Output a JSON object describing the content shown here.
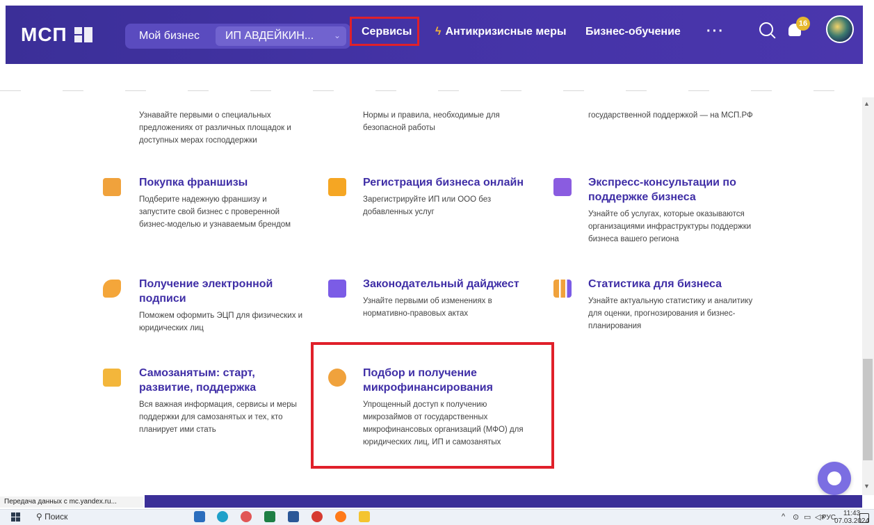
{
  "header": {
    "logo": "МСП",
    "my_business_label": "Мой бизнес",
    "business_select_value": "ИП АВДЕЙКИН...",
    "nav": {
      "services": "Сервисы",
      "anticrisis": "Антикризисные меры",
      "education": "Бизнес-обучение",
      "more": "···"
    },
    "notifications_count": "16"
  },
  "cards_top_partial": [
    {
      "desc": "Узнавайте первыми о специальных предложениях от различных площадок и доступных мерах господдержки"
    },
    {
      "desc": "Нормы и правила, необходимые для безопасной работы"
    },
    {
      "desc": "государственной поддержкой — на МСП.РФ"
    }
  ],
  "cards": [
    {
      "title": "Покупка франшизы",
      "desc": "Подберите надежную франшизу и запустите свой бизнес с проверенной бизнес-моделью и узнаваемым брендом",
      "icon": "franchise-icon",
      "color": "#f0a23c"
    },
    {
      "title": "Регистрация бизнеса онлайн",
      "desc": "Зарегистрируйте ИП или ООО без добавленных услуг",
      "icon": "briefcase-icon",
      "color": "#f5a623"
    },
    {
      "title": "Экспресс-консультации по поддержке бизнеса",
      "desc": "Узнайте об услугах, которые оказываются организациями инфраструктуры поддержки бизнеса вашего региона",
      "icon": "consult-icon",
      "color": "#8a5ce0"
    },
    {
      "title": "Получение электронной подписи",
      "desc": "Поможем оформить ЭЦП для физических и юридических лиц",
      "icon": "signature-icon",
      "color": "#f4a63a"
    },
    {
      "title": "Законодательный дайджест",
      "desc": "Узнайте первыми об изменениях в нормативно-правовых актах",
      "icon": "book-icon",
      "color": "#7b5ce6"
    },
    {
      "title": "Статистика для бизнеса",
      "desc": "Узнайте актуальную статистику и аналитику для оценки, прогнозирования и бизнес-планирования",
      "icon": "stats-icon",
      "color": "#f0a23c"
    },
    {
      "title": "Самозанятым: старт, развитие, поддержка",
      "desc": "Вся важная информация, сервисы и меры поддержки для самозанятых и тех, кто планирует ими стать",
      "icon": "selfemployed-icon",
      "color": "#f3b63b"
    },
    {
      "title": "Подбор и получение микрофинансирования",
      "desc": "Упрощенный доступ к получению микрозаймов от государственных микрофинансовых организаций (МФО) для юридических лиц, ИП и самозанятых",
      "icon": "microfinance-icon",
      "color": "#f0a23c"
    }
  ],
  "status_bar_text": "Передача данных с mc.yandex.ru...",
  "taskbar": {
    "search_label": "Поиск",
    "tray_lang": "РУС",
    "time": "11:43",
    "date": "07.03.2024"
  }
}
